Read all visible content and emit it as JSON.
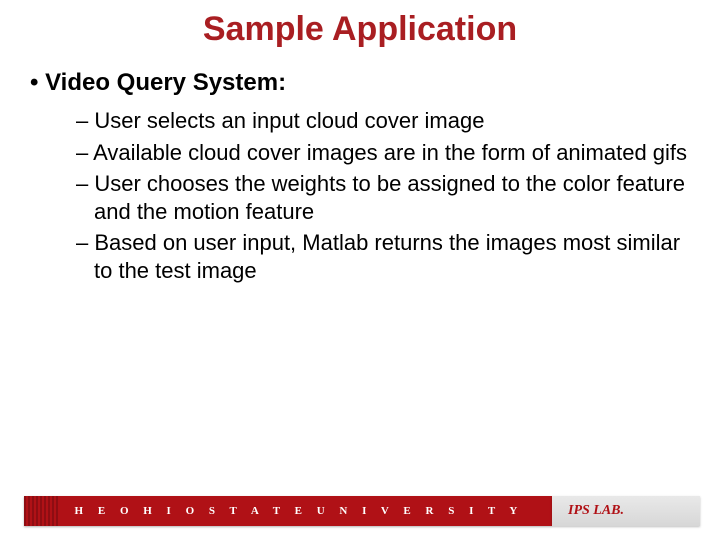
{
  "title": "Sample Application",
  "bullet": {
    "label": "Video Query System:",
    "subs": [
      "User selects an input cloud cover image",
      "Available cloud cover images are in the form of animated gifs",
      "User chooses the weights to be assigned to the color feature and the motion feature",
      "Based on user input, Matlab returns the images most similar to the test image"
    ]
  },
  "footer": {
    "university": "T H E   O H I O   S T A T E   U N I V E R S I T Y",
    "lab": "IPS LAB."
  }
}
